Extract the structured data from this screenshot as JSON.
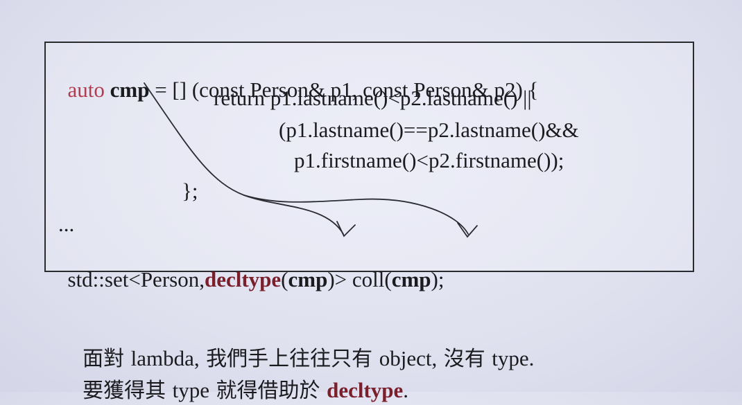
{
  "code": {
    "line1": {
      "kw_auto": "auto",
      "sp1": " ",
      "name": "cmp",
      "rest": " = [] (const Person& p1, const Person& p2) {"
    },
    "line2": "return p1.lastname()<p2.lastname() ||",
    "line3": "(p1.lastname()==p2.lastname()&&",
    "line4": "p1.firstname()<p2.firstname());",
    "line5": "};",
    "line6": "...",
    "line7": {
      "pre": "std::set<Person,",
      "decltype": "decltype",
      "open": "(",
      "cmp1": "cmp",
      "mid": ")> coll(",
      "cmp2": "cmp",
      "end": ");"
    }
  },
  "caption": {
    "l1_a": "面對 ",
    "l1_b": "lambda,",
    "l1_c": " 我們手上往往只有 ",
    "l1_d": "object,",
    "l1_e": " 沒有 ",
    "l1_f": "type.",
    "l2_a": "要獲得其 ",
    "l2_b": "type",
    "l2_c": " 就得借助於 ",
    "l2_d": "decltype",
    "l2_e": "."
  },
  "colors": {
    "keyword": "#b23d4f",
    "decltype": "#7a1f2c",
    "text": "#1b1b1f",
    "background": "#e3e5f2"
  }
}
